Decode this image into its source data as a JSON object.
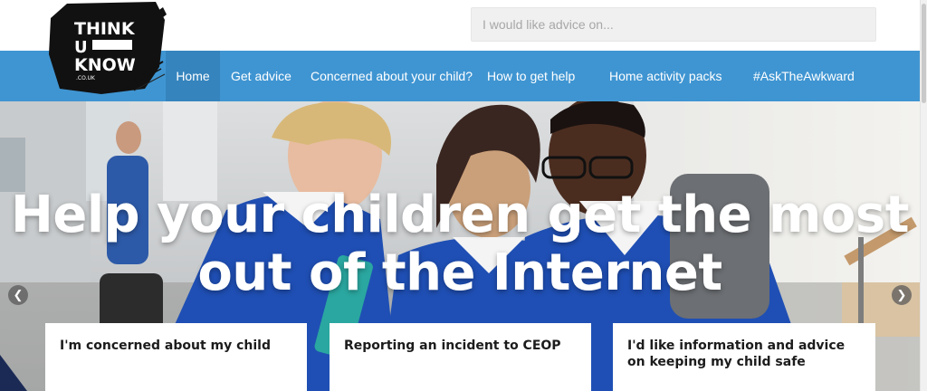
{
  "logo": {
    "line1": "THINK",
    "line2": "U",
    "line3": "KNOW",
    "domain": ".CO.UK"
  },
  "search": {
    "placeholder": "I would like advice on..."
  },
  "nav": {
    "items": [
      {
        "label": "Home",
        "active": true
      },
      {
        "label": "Get advice"
      },
      {
        "label": "Concerned about your child?"
      },
      {
        "label": "How to get help"
      },
      {
        "label": "Home activity packs"
      },
      {
        "label": "#AskTheAwkward"
      }
    ]
  },
  "hero": {
    "title": "Help your children get the most out of the Internet",
    "prev_icon": "chevron-left-icon",
    "next_icon": "chevron-right-icon"
  },
  "cards": [
    {
      "title": "I'm concerned about my child"
    },
    {
      "title": "Reporting an incident to CEOP"
    },
    {
      "title": "I'd like information and advice on keeping my child safe"
    }
  ],
  "colors": {
    "nav_bg": "#3f95d2",
    "nav_active": "#3584bd",
    "uniform_blue": "#1f4fb4"
  }
}
